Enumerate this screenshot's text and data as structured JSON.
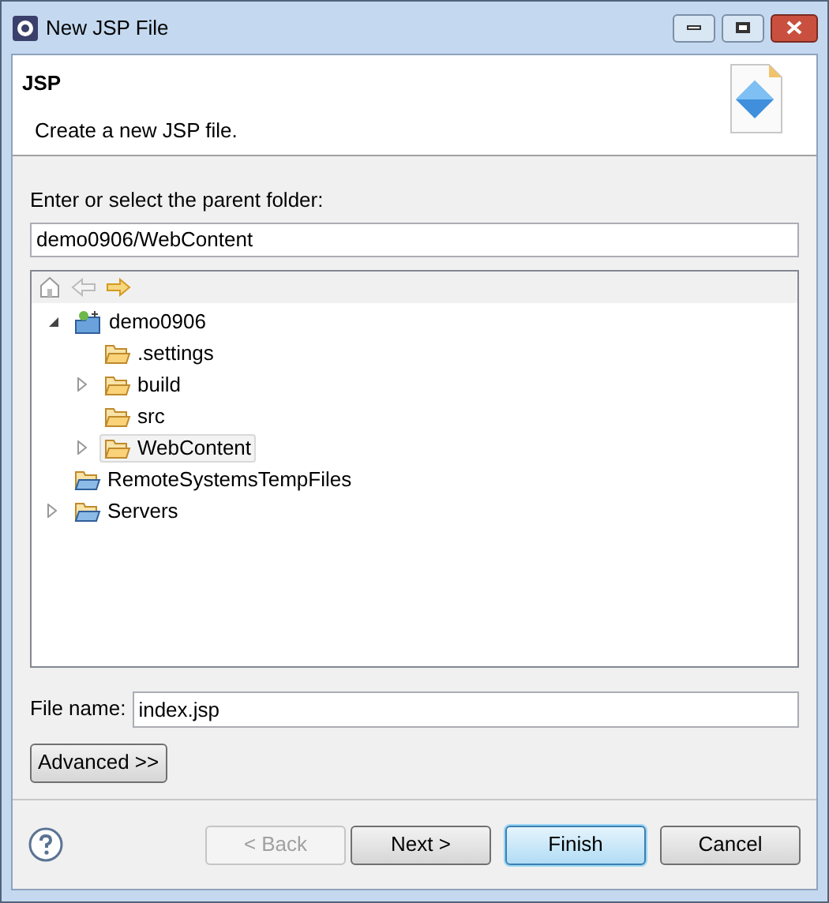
{
  "window": {
    "title": "New JSP File"
  },
  "banner": {
    "title": "JSP",
    "description": "Create a new JSP file."
  },
  "parent_folder": {
    "label": "Enter or select the parent folder:",
    "value": "demo0906/WebContent"
  },
  "tree": [
    {
      "label": "demo0906",
      "kind": "project",
      "expanded": true,
      "selected": false,
      "children": [
        {
          "label": ".settings",
          "kind": "folder",
          "selected": false
        },
        {
          "label": "build",
          "kind": "folder",
          "expanded": false,
          "selected": false
        },
        {
          "label": "src",
          "kind": "folder",
          "selected": false
        },
        {
          "label": "WebContent",
          "kind": "folder",
          "expanded": false,
          "selected": true
        }
      ]
    },
    {
      "label": "RemoteSystemsTempFiles",
      "kind": "blue-folder",
      "selected": false
    },
    {
      "label": "Servers",
      "kind": "blue-folder",
      "expanded": false,
      "selected": false
    }
  ],
  "file_name": {
    "label": "File name:",
    "value": "index.jsp"
  },
  "advanced_button": "Advanced >>",
  "buttons": [
    {
      "label": "< Back",
      "disabled": true,
      "default": false
    },
    {
      "label": "Next >",
      "disabled": false,
      "default": false
    },
    {
      "label": "Finish",
      "disabled": false,
      "default": true
    },
    {
      "label": "Cancel",
      "disabled": false,
      "default": false
    }
  ]
}
